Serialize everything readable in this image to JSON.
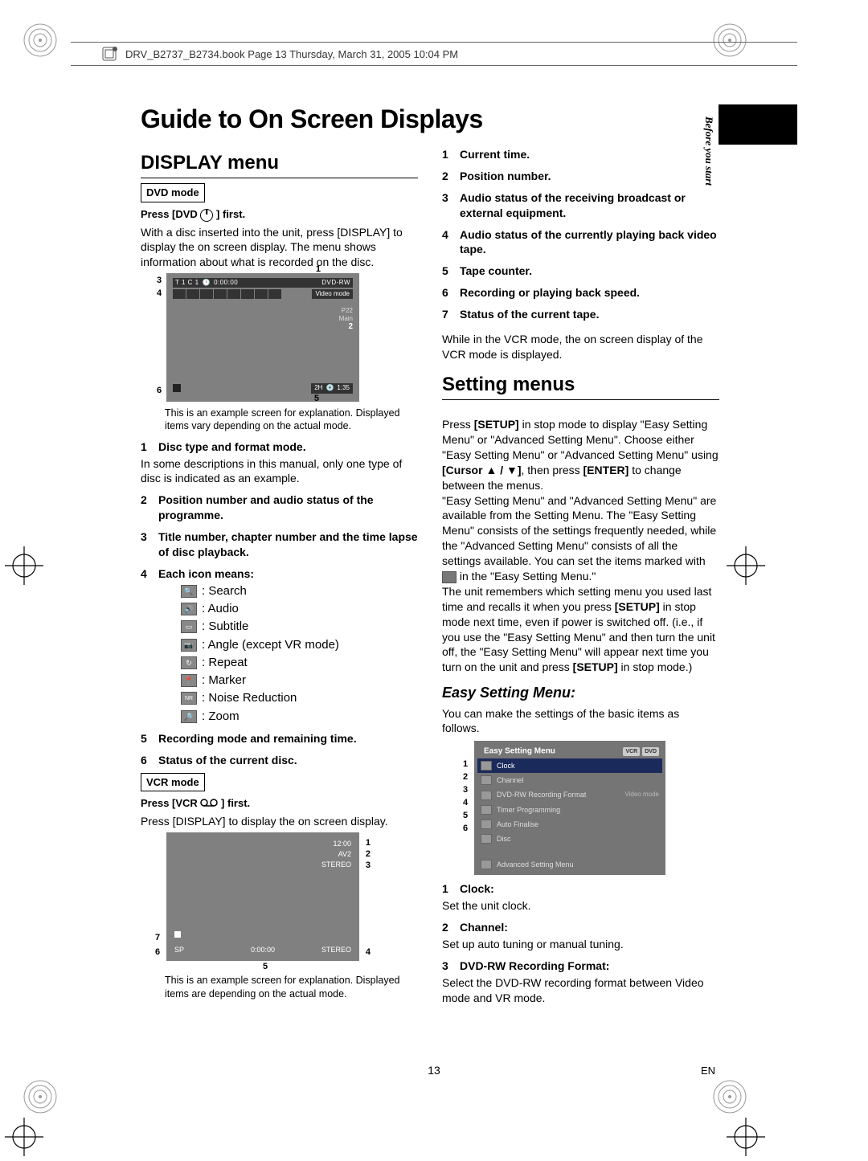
{
  "header": {
    "bookline": "DRV_B2737_B2734.book  Page 13  Thursday, March 31, 2005  10:04 PM"
  },
  "page": {
    "number": "13",
    "lang": "EN",
    "sidebar_label": "Before you start"
  },
  "title": "Guide to On Screen Displays",
  "left": {
    "section1": "DISPLAY menu",
    "dvd_mode": "DVD mode",
    "press_dvd": "Press [DVD ",
    "press_dvd_end": "] first.",
    "dvd_intro": "With a disc inserted into the unit, press [DISPLAY] to display the on screen display. The menu shows information about what is recorded on the disc.",
    "osd": {
      "top_left": "T  1  C  1",
      "time": "0:00:00",
      "top_right": "DVD-RW",
      "video_mode": "Video mode",
      "p22": "P22",
      "main": "Main",
      "callout2": "2",
      "bottom_mode": "2H",
      "bottom_time": "1:35",
      "c1": "1",
      "c3": "3",
      "c4": "4",
      "c5": "5",
      "c6": "6"
    },
    "example_note": "This is an example screen for explanation. Displayed items vary depending on the actual mode.",
    "item1": {
      "n": "1",
      "t": "Disc type and format mode."
    },
    "item1_desc": "In some descriptions in this manual, only one type of disc is indicated as an example.",
    "item2": {
      "n": "2",
      "t": "Position number and audio status of the programme."
    },
    "item3": {
      "n": "3",
      "t": "Title number, chapter number and the time lapse of disc playback."
    },
    "item4": {
      "n": "4",
      "t": "Each icon means:"
    },
    "icons": {
      "search": ": Search",
      "audio": ": Audio",
      "subtitle": ": Subtitle",
      "angle": ": Angle (except VR mode)",
      "repeat": ": Repeat",
      "marker": ": Marker",
      "nr": ": Noise Reduction",
      "zoom": ": Zoom"
    },
    "item5": {
      "n": "5",
      "t": "Recording mode and remaining time."
    },
    "item6": {
      "n": "6",
      "t": "Status of the current disc."
    },
    "vcr_mode": "VCR mode",
    "press_vcr": "Press [VCR ",
    "press_vcr_end": "] first.",
    "vcr_intro": "Press [DISPLAY] to display the on screen display.",
    "vcr": {
      "time": "12:00",
      "av": "AV2",
      "stereo_top": "STEREO",
      "sp": "SP",
      "counter": "0:00:00",
      "stereo_bot": "STEREO",
      "c1": "1",
      "c2": "2",
      "c3": "3",
      "c4": "4",
      "c5": "5",
      "c6": "6",
      "c7": "7"
    },
    "vcr_note": "This is an example screen for explanation. Displayed items are depending on the actual mode."
  },
  "right": {
    "r1": {
      "n": "1",
      "t": "Current time."
    },
    "r2": {
      "n": "2",
      "t": "Position number."
    },
    "r3": {
      "n": "3",
      "t": "Audio status of the receiving broadcast or external equipment."
    },
    "r4": {
      "n": "4",
      "t": "Audio status of the currently playing back video tape."
    },
    "r5": {
      "n": "5",
      "t": "Tape counter."
    },
    "r6": {
      "n": "6",
      "t": "Recording or playing back speed."
    },
    "r7": {
      "n": "7",
      "t": "Status of the current tape."
    },
    "vcr_par": "While in the VCR mode, the on screen display of the VCR mode is displayed.",
    "section2": "Setting menus",
    "setting_par": "Press [SETUP] in stop mode to display \"Easy Setting Menu\" or \"Advanced Setting Menu\". Choose either \"Easy Setting Menu\" or \"Advanced Setting Menu\" using [Cursor ▲ / ▼], then press [ENTER] to change between the menus.\n\"Easy Setting Menu\" and \"Advanced Setting Menu\" are available from the Setting Menu. The \"Easy Setting Menu\" consists of the settings frequently needed, while the \"Advanced Setting Menu\" consists of all the settings available. You can set the items marked with  in the \"Easy Setting Menu.\"\nThe unit remembers which setting menu you used last time and recalls it when you press [SETUP] in stop mode next time, even if power is switched off. (i.e., if you use the \"Easy Setting Menu\" and then turn the unit off, the \"Easy Setting Menu\" will appear next time you turn on the unit and press [SETUP] in stop mode.)",
    "easy_heading": "Easy Setting Menu:",
    "easy_desc": "You can make the settings of the basic items as follows.",
    "menu": {
      "title": "Easy Setting Menu",
      "pill1": "VCR",
      "pill2": "DVD",
      "i1": "Clock",
      "i2": "Channel",
      "i3": "DVD-RW Recording Format",
      "i3r": "Video mode",
      "i4": "Timer Programming",
      "i5": "Auto Finalise",
      "i6": "Disc",
      "adv": "Advanced Setting Menu",
      "c1": "1",
      "c2": "2",
      "c3": "3",
      "c4": "4",
      "c5": "5",
      "c6": "6"
    },
    "m1": {
      "n": "1",
      "t": "Clock:"
    },
    "m1d": "Set the unit clock.",
    "m2": {
      "n": "2",
      "t": "Channel:"
    },
    "m2d": "Set up auto tuning or manual tuning.",
    "m3": {
      "n": "3",
      "t": "DVD-RW Recording Format:"
    },
    "m3d": "Select the DVD-RW recording format between Video mode and VR mode."
  }
}
